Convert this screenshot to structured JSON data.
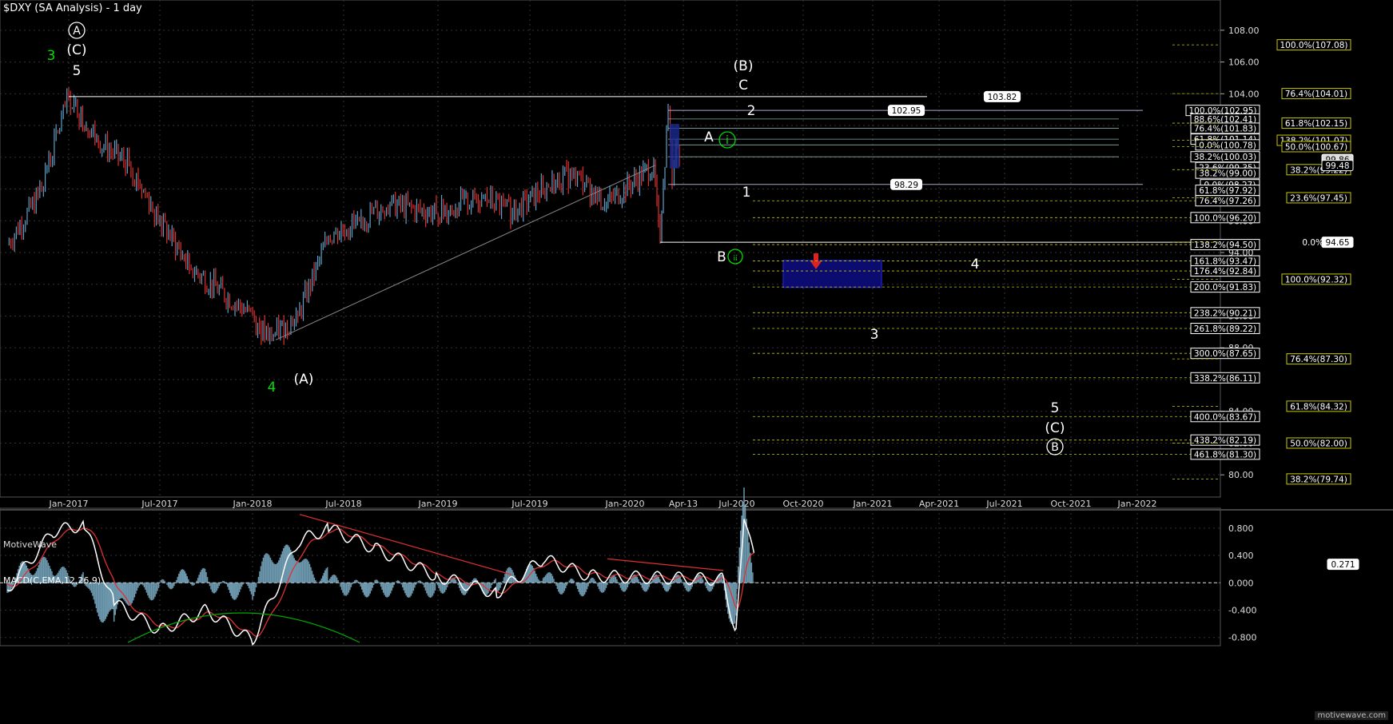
{
  "title": "$DXY (SA Analysis) - 1 day",
  "watermark": "MotiveWave",
  "macd_title": "MACD(C,EMA,12,26,9)",
  "corner_brand": "motivewave.com",
  "colors": {
    "bg": "#000000",
    "up": "#5ea0c8",
    "down": "#e03030",
    "macd": "#ffffff",
    "signal": "#e03030",
    "hist": "#7fb2cc",
    "fib": "#c8c800",
    "wave": "#ffffff",
    "green": "#00e000",
    "box": "#2020c0"
  },
  "chart_data": [
    {
      "type": "line",
      "name": "price",
      "ylim": [
        78.6,
        109.2
      ],
      "y_ticks": [
        "108.00",
        "106.00",
        "104.00",
        "102.00",
        "100.00",
        "98.00",
        "96.00",
        "94.00",
        "92.00",
        "90.00",
        "88.00",
        "86.00",
        "84.00",
        "82.00",
        "80.00"
      ],
      "x_ticks": [
        "Jan-2017",
        "Jul-2017",
        "Jan-2018",
        "Jul-2018",
        "Jan-2019",
        "Jul-2019",
        "Jan-2020",
        "Apr-13",
        "Jul-2020",
        "Oct-2020",
        "Jan-2021",
        "Apr-2021",
        "Jul-2021",
        "Oct-2021",
        "Jan-2022"
      ],
      "x": [
        "2016-09",
        "2016-11",
        "2017-01",
        "2017-03",
        "2017-05",
        "2017-07",
        "2017-09",
        "2018-01",
        "2018-02",
        "2018-04",
        "2018-06",
        "2018-08",
        "2018-10",
        "2019-01",
        "2019-04",
        "2019-06",
        "2019-08",
        "2019-10",
        "2019-12",
        "2020-02",
        "2020-03",
        "2020-03",
        "2020-03",
        "2020-03",
        "2020-04"
      ],
      "y": [
        94.5,
        97.5,
        103.8,
        101,
        99.5,
        96,
        93,
        90,
        88.5,
        90,
        95,
        96,
        97,
        96.5,
        97.5,
        96.5,
        98,
        99,
        97,
        99.5,
        94.65,
        102.95,
        98.3,
        101,
        99.5
      ],
      "wave_labels": [
        {
          "t": "3",
          "c": "green"
        },
        {
          "t": "A",
          "c": "white",
          "circle": true
        },
        {
          "t": "(C)",
          "c": "white"
        },
        {
          "t": "5",
          "c": "white"
        },
        {
          "t": "4",
          "c": "green"
        },
        {
          "t": "(A)",
          "c": "white"
        },
        {
          "t": "(B)",
          "c": "white"
        },
        {
          "t": "C",
          "c": "white"
        },
        {
          "t": "A",
          "c": "white"
        },
        {
          "t": "i",
          "c": "green",
          "circle": true
        },
        {
          "t": "B",
          "c": "white"
        },
        {
          "t": "ii",
          "c": "green",
          "circle": true
        },
        {
          "t": "2",
          "c": "white"
        },
        {
          "t": "1",
          "c": "white"
        },
        {
          "t": "4",
          "c": "white"
        },
        {
          "t": "3",
          "c": "white"
        },
        {
          "t": "5",
          "c": "white"
        },
        {
          "t": "(C)",
          "c": "white"
        },
        {
          "t": "B",
          "c": "white",
          "circle": true
        }
      ],
      "levels_white": [
        {
          "text": "103.82",
          "price": 103.82
        },
        {
          "text": "102.95",
          "price": 102.95
        },
        {
          "text": "98.29",
          "price": 98.29
        }
      ],
      "fib_center": [
        {
          "text": "100.0%(102.95)",
          "price": 102.95
        },
        {
          "text": "88.6%(102.41)",
          "price": 102.41
        },
        {
          "text": "76.4%(101.83)",
          "price": 101.83
        },
        {
          "text": "61.8%(101.14)",
          "price": 101.14
        },
        {
          "text": "0.0%(100.78)",
          "price": 100.78
        },
        {
          "text": "38.2%(100.03)",
          "price": 100.03
        },
        {
          "text": "23.6%(99.35)",
          "price": 99.35
        },
        {
          "text": "38.2%(99.00)",
          "price": 99.0
        },
        {
          "text": "0.0%(98.27)",
          "price": 98.27
        },
        {
          "text": "61.8%(97.92)",
          "price": 97.92
        },
        {
          "text": "76.4%(97.26)",
          "price": 97.26
        },
        {
          "text": "100.0%(96.20)",
          "price": 96.2
        },
        {
          "text": "138.2%(94.50)",
          "price": 94.5
        },
        {
          "text": "161.8%(93.47)",
          "price": 93.47
        },
        {
          "text": "176.4%(92.84)",
          "price": 92.84
        },
        {
          "text": "200.0%(91.83)",
          "price": 91.83
        },
        {
          "text": "238.2%(90.21)",
          "price": 90.21
        },
        {
          "text": "261.8%(89.22)",
          "price": 89.22
        },
        {
          "text": "300.0%(87.65)",
          "price": 87.65
        },
        {
          "text": "338.2%(86.11)",
          "price": 86.11
        },
        {
          "text": "400.0%(83.67)",
          "price": 83.67
        },
        {
          "text": "438.2%(82.19)",
          "price": 82.19
        },
        {
          "text": "461.8%(81.30)",
          "price": 81.3
        }
      ],
      "fib_right": [
        {
          "text": "100.0%(107.08)",
          "price": 107.08
        },
        {
          "text": "76.4%(104.01)",
          "price": 104.01
        },
        {
          "text": "61.8%(102.15)",
          "price": 102.15
        },
        {
          "text": "138.2%(101.07)",
          "price": 101.07
        },
        {
          "text": "50.0%(100.67)",
          "price": 100.67
        },
        {
          "text": "38.2%(99.22)",
          "price": 99.22
        },
        {
          "text": "23.6%(97.45)",
          "price": 97.45
        },
        {
          "text": "0.0%",
          "price": 94.65
        },
        {
          "text": "100.0%(92.32)",
          "price": 92.32
        },
        {
          "text": "76.4%(87.30)",
          "price": 87.3
        },
        {
          "text": "61.8%(84.32)",
          "price": 84.32
        },
        {
          "text": "50.0%(82.00)",
          "price": 82.0
        },
        {
          "text": "38.2%(79.74)",
          "price": 79.74
        }
      ],
      "right_tags": [
        {
          "text": "94.65",
          "price": 94.65
        },
        {
          "text": "99.86",
          "price": 99.86
        },
        {
          "text": "99.48",
          "price": 99.48
        }
      ]
    },
    {
      "type": "line",
      "name": "MACD",
      "ylim": [
        -0.85,
        1.02
      ],
      "y_ticks": [
        "0.800",
        "0.400",
        "0.000",
        "-0.400",
        "-0.800"
      ],
      "last_value": "0.271",
      "x": [
        "2016-09",
        "2016-12",
        "2017-02",
        "2017-04",
        "2017-07",
        "2017-10",
        "2018-01",
        "2018-04",
        "2018-06",
        "2018-09",
        "2019-01",
        "2019-05",
        "2019-08",
        "2019-11",
        "2020-01",
        "2020-03",
        "2020-03",
        "2020-04"
      ],
      "y": [
        -0.1,
        0.75,
        0.85,
        -0.3,
        -0.7,
        -0.4,
        -0.85,
        0.6,
        0.8,
        0.5,
        0.1,
        -0.15,
        0.35,
        0.1,
        0.05,
        -0.75,
        1.0,
        0.271
      ]
    }
  ]
}
